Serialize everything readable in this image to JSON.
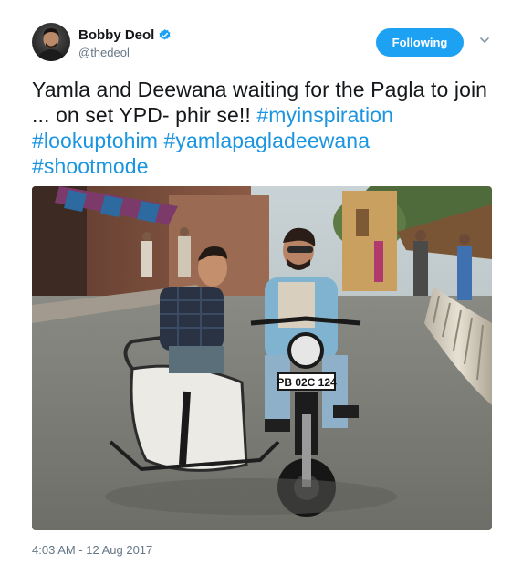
{
  "user": {
    "display_name": "Bobby Deol",
    "handle": "@thedeol",
    "verified": true,
    "avatar_icon": "profile-photo"
  },
  "actions": {
    "follow_label": "Following",
    "menu_icon": "chevron-down-icon"
  },
  "tweet": {
    "text_intro": "Yamla and Deewana waiting for the Pagla to join ... on set YPD- phir se!! ",
    "hashtags": [
      "#myinspiration",
      "#lookuptohim",
      "#yamlapagladeewana",
      "#shootmode"
    ],
    "photo": {
      "alt": "photo",
      "license_plate": "PB 02C 124"
    },
    "timestamp": "4:03 AM - 12 Aug 2017"
  },
  "colors": {
    "accent": "#1da1f2",
    "link": "#1b95e0",
    "text": "#14171a",
    "muted": "#657786"
  }
}
